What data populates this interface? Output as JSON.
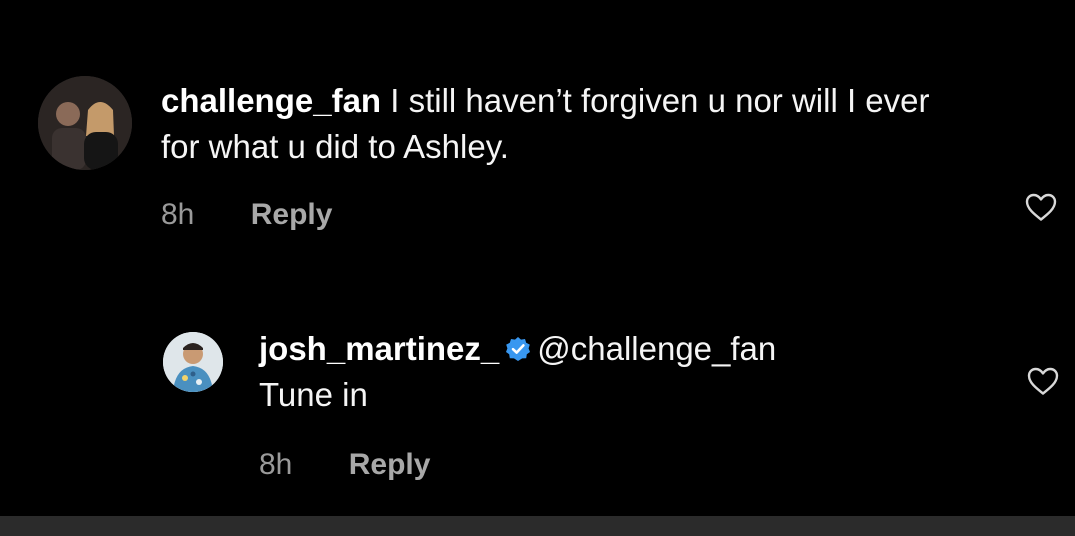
{
  "comments": {
    "main": {
      "username": "challenge_fan",
      "text": "I still haven’t forgiven u nor will I ever for what u did to Ashley.",
      "time": "8h",
      "reply_label": "Reply",
      "avatar_icon": "profile-photo-couple"
    },
    "reply": {
      "username": "josh_martinez_",
      "verified": true,
      "mention": "@challenge_fan",
      "text": "Tune in",
      "time": "8h",
      "reply_label": "Reply",
      "avatar_icon": "profile-photo-man"
    }
  },
  "icons": {
    "like": "heart-outline-icon",
    "verified": "verified-badge-icon"
  },
  "colors": {
    "background": "#000000",
    "text": "#f5f5f5",
    "meta": "#9a9a9a",
    "verified": "#3897f0",
    "bottom_bar": "#2b2b2b"
  }
}
